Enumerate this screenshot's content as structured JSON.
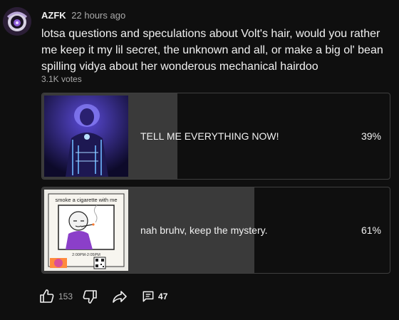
{
  "post": {
    "author": "AZFK",
    "time": "22 hours ago",
    "text": "lotsa questions and speculations about Volt's hair, would you rather me keep it my lil secret, the unknown and all, or make a big ol' bean spilling vidya about her wonderous mechanical hairdoo",
    "votes": "3.1K votes"
  },
  "poll": {
    "options": [
      {
        "label": "TELL ME EVERYTHING NOW!",
        "percent_text": "39%",
        "percent": 39,
        "image": "cyberpunk-character-thumbnail"
      },
      {
        "label": "nah bruhv, keep the mystery.",
        "percent_text": "61%",
        "percent": 61,
        "image": "smoke-a-cigarette-sticker-thumbnail",
        "image_texts": {
          "caption": "smoke a cigarette with me",
          "time": "2:00PM-2:05PM"
        }
      }
    ]
  },
  "actions": {
    "like_count": "153",
    "comments_count": "47",
    "icons": [
      "thumbs-up-icon",
      "thumbs-down-icon",
      "share-icon",
      "comment-icon"
    ]
  },
  "colors": {
    "background": "#0f0f0f",
    "poll_fill": "#3a3a3a",
    "border": "#3f3f3f",
    "text": "#f1f1f1",
    "muted": "#aaaaaa",
    "thumb_purple": "#7a5cff"
  }
}
